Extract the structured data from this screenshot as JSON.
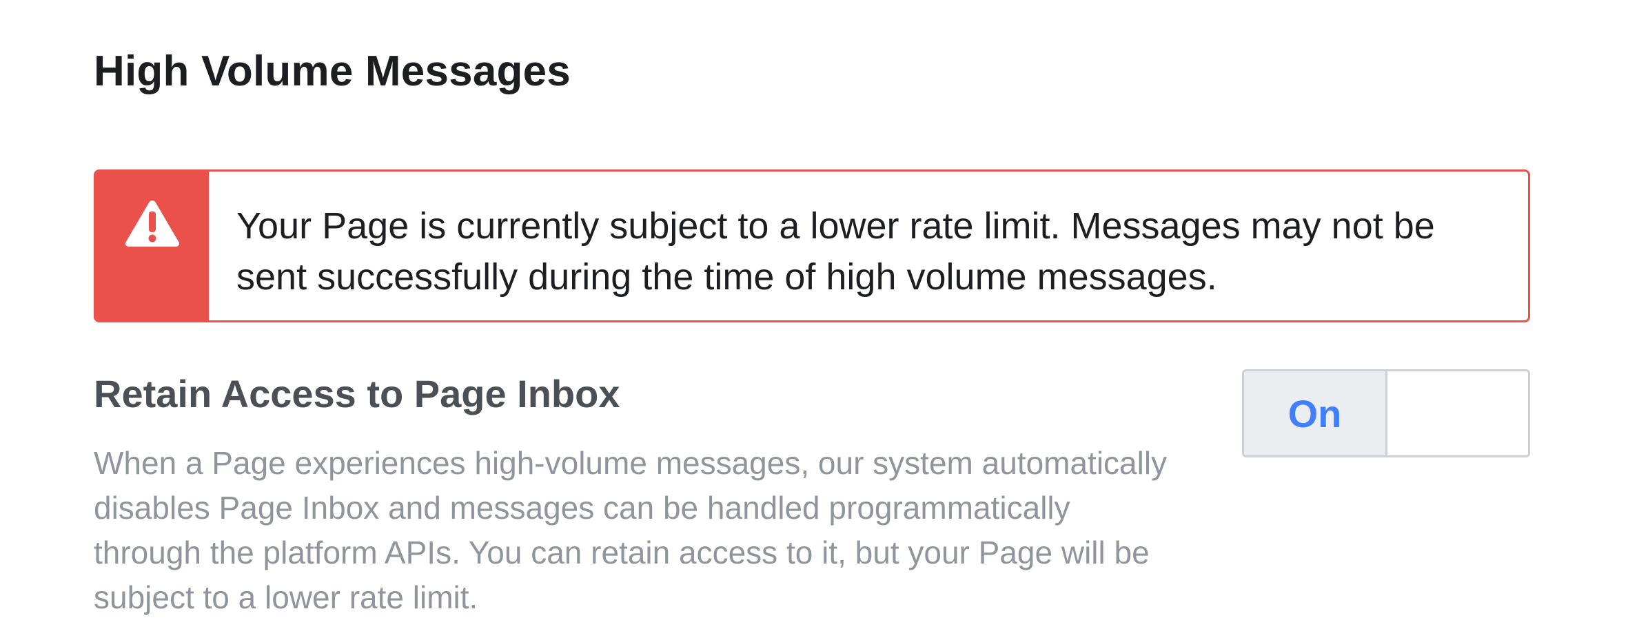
{
  "header": {
    "title": "High Volume Messages"
  },
  "alert": {
    "icon": "warning-triangle-icon",
    "message": "Your Page is currently subject to a lower rate limit. Messages may not be sent successfully during the time of high volume messages.",
    "color": "#e9514a"
  },
  "setting": {
    "title": "Retain Access to Page Inbox",
    "description": "When a Page experiences high-volume messages, our system automatically disables Page Inbox and messages can be handled programmatically through the platform APIs. You can retain access to it, but your Page will be subject to a lower rate limit.",
    "toggle": {
      "on_label": "On",
      "state": "on",
      "accent_color": "#4080ff"
    }
  }
}
